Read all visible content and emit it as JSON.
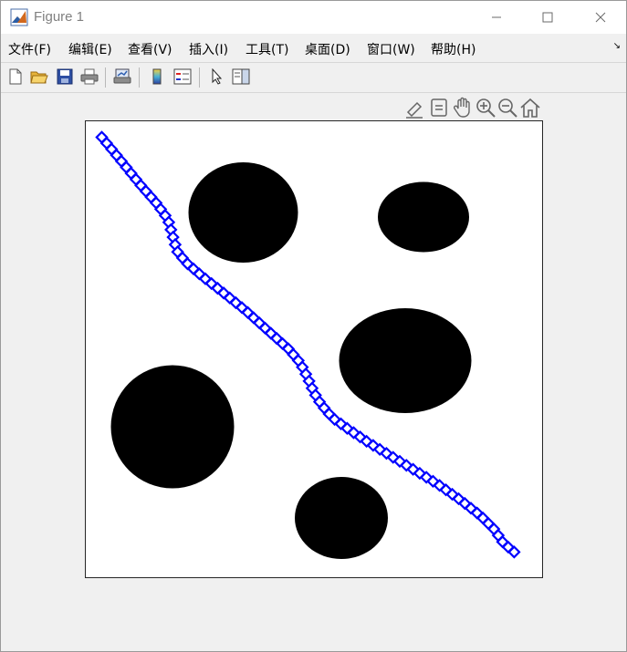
{
  "window": {
    "title": "Figure 1"
  },
  "menus": [
    "文件(F)",
    "编辑(E)",
    "查看(V)",
    "插入(I)",
    "工具(T)",
    "桌面(D)",
    "窗口(W)",
    "帮助(H)"
  ],
  "toolbar_icons": [
    "new-figure-icon",
    "open-file-icon",
    "save-icon",
    "print-icon",
    "link-plot-icon",
    "colorbar-icon",
    "legend-icon",
    "edit-plot-arrow-icon",
    "property-inspector-icon"
  ],
  "axes_toolbar_icons": [
    "brush-icon",
    "data-tips-icon",
    "pan-hand-icon",
    "zoom-in-icon",
    "zoom-out-icon",
    "restore-view-home-icon"
  ],
  "colors": {
    "path": "#0000ff",
    "obstacle": "#000000",
    "axes_border": "#262626"
  },
  "chart_data": {
    "type": "scatter",
    "xlim": [
      0,
      100
    ],
    "ylim": [
      0,
      100
    ],
    "grid": false,
    "obstacles": [
      {
        "cx": 34.5,
        "cy": 80,
        "rx": 12,
        "ry": 11
      },
      {
        "cx": 74,
        "cy": 79,
        "rx": 10,
        "ry": 7.7
      },
      {
        "cx": 70,
        "cy": 47.5,
        "rx": 14.5,
        "ry": 11.5
      },
      {
        "cx": 19,
        "cy": 33,
        "rx": 13.5,
        "ry": 13.5
      },
      {
        "cx": 56,
        "cy": 13,
        "rx": 10.2,
        "ry": 9
      }
    ],
    "path": [
      [
        3.5,
        96.5
      ],
      [
        8,
        91
      ],
      [
        12,
        86
      ],
      [
        15.5,
        82
      ],
      [
        18,
        78.5
      ],
      [
        19,
        75
      ],
      [
        20,
        71.5
      ],
      [
        22,
        69
      ],
      [
        25.5,
        66
      ],
      [
        30,
        62.5
      ],
      [
        35,
        58.5
      ],
      [
        40,
        54
      ],
      [
        44.5,
        50
      ],
      [
        47,
        47
      ],
      [
        48.5,
        44
      ],
      [
        50,
        40.5
      ],
      [
        51.5,
        38
      ],
      [
        54,
        35
      ],
      [
        57.5,
        32.5
      ],
      [
        62,
        29.5
      ],
      [
        67,
        26.5
      ],
      [
        72,
        23.5
      ],
      [
        77,
        20.5
      ],
      [
        82,
        17
      ],
      [
        86.5,
        13.5
      ],
      [
        89.5,
        10.5
      ],
      [
        91.5,
        7.5
      ],
      [
        94.5,
        5
      ]
    ]
  }
}
